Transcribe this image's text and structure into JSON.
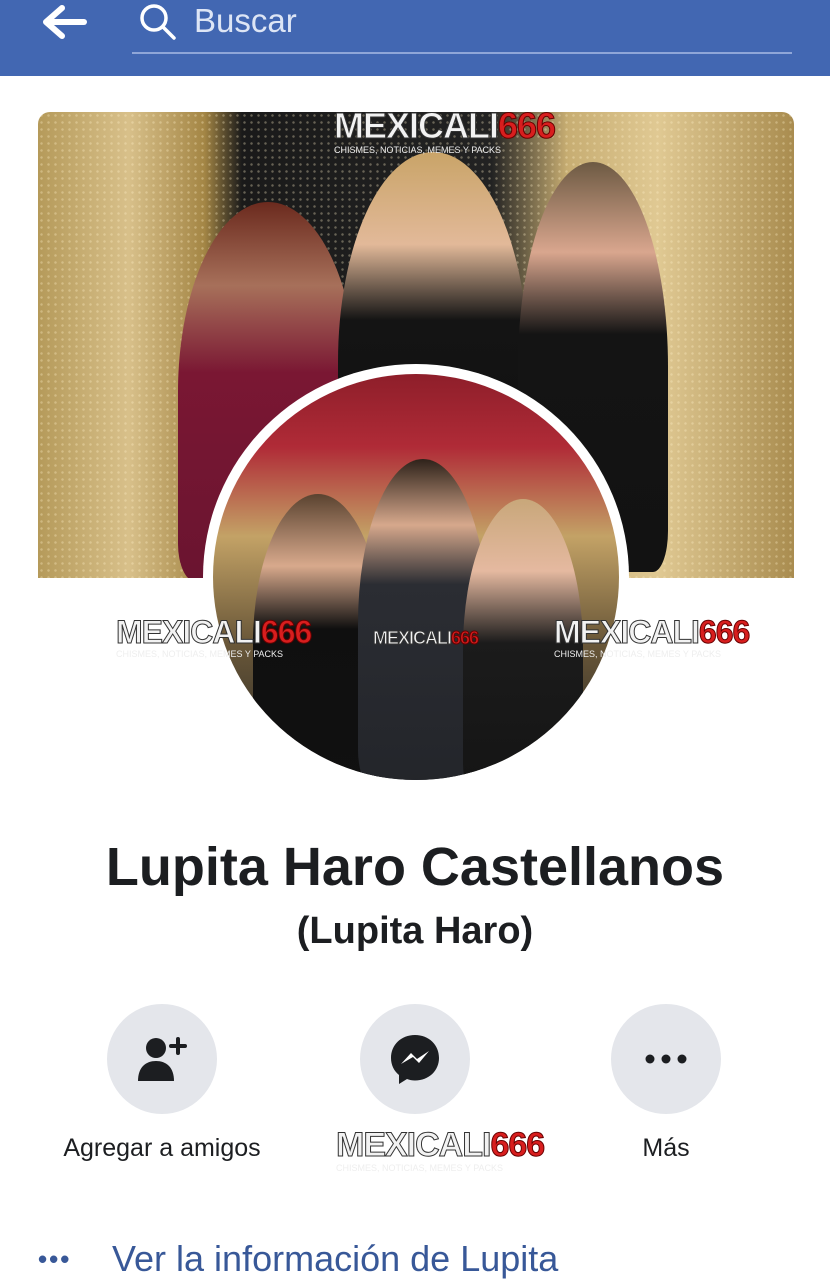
{
  "header": {
    "search_placeholder": "Buscar",
    "background_color": "#4267b2"
  },
  "profile": {
    "name": "Lupita Haro Castellanos",
    "alternate_name": "(Lupita Haro)"
  },
  "watermark": {
    "text_main": "MEXICALI",
    "text_number": "666",
    "tagline": "CHISMES, NOTICIAS, MEMES Y PACKS"
  },
  "actions": {
    "add_friend_label": "Agregar a amigos",
    "more_label": "Más"
  },
  "info_link": {
    "label": "Ver la información de Lupita",
    "dots": "•••"
  },
  "colors": {
    "link": "#385898",
    "action_bg": "#e4e6eb",
    "text": "#1c1e21"
  },
  "icons": [
    "back-arrow-icon",
    "search-icon",
    "add-friend-icon",
    "messenger-icon",
    "more-icon"
  ]
}
